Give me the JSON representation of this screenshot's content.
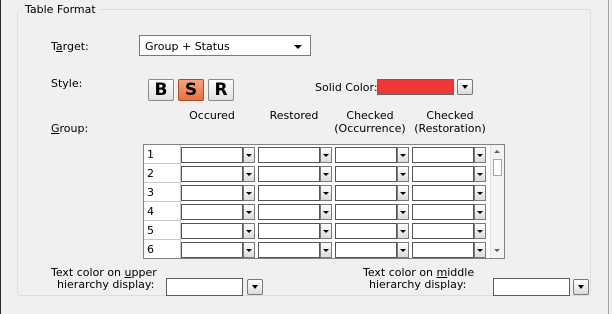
{
  "group_title": "Table Format",
  "target": {
    "label_pre": "T",
    "label_ul": "a",
    "label_post": "rget:",
    "value": "Group + Status"
  },
  "style": {
    "label": "Style:",
    "buttons": [
      "B",
      "S",
      "R"
    ],
    "selected": "S",
    "solid_color_label": "Solid Color:",
    "solid_color": "#f03838"
  },
  "group": {
    "label_ul": "G",
    "label_post": "roup:",
    "columns": [
      {
        "line1": "",
        "line2": "Occured"
      },
      {
        "line1": "",
        "line2": "Restored"
      },
      {
        "line1": "Checked",
        "line2": "(Occurrence)"
      },
      {
        "line1": "Checked",
        "line2": "(Restoration)"
      }
    ],
    "rows": [
      "1",
      "2",
      "3",
      "4",
      "5",
      "6"
    ]
  },
  "upper_color": {
    "line1_pre": "Text color on ",
    "line1_ul": "u",
    "line1_post": "pper",
    "line2": "hierarchy display:"
  },
  "middle_color": {
    "line1_pre": "Text color on ",
    "line1_ul": "m",
    "line1_post": "iddle",
    "line2": "hierarchy display:"
  }
}
